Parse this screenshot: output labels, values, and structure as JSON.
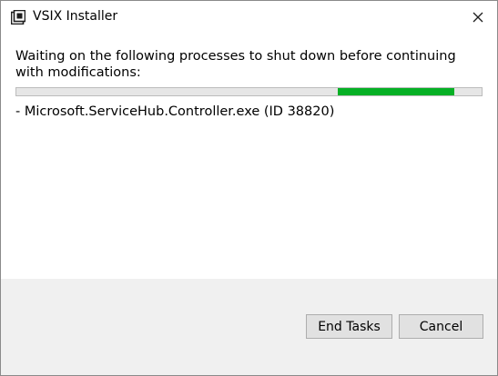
{
  "window": {
    "title": "VSIX Installer",
    "icon": "vsix-installer-icon",
    "close_icon": "close-icon"
  },
  "main": {
    "message": "Waiting on the following processes to shut down before continuing with modifications:",
    "progress": {
      "state": "indeterminate",
      "fill_start_fraction": 0.69,
      "fill_end_fraction": 0.94,
      "fill_color": "#06b025"
    },
    "process_item": "- Microsoft.ServiceHub.Controller.exe (ID 38820)"
  },
  "footer": {
    "end_tasks_label": "End Tasks",
    "cancel_label": "Cancel"
  },
  "colors": {
    "progress_fill": "#06b025",
    "footer_background": "#f0f0f0",
    "button_background": "#e1e1e1"
  }
}
